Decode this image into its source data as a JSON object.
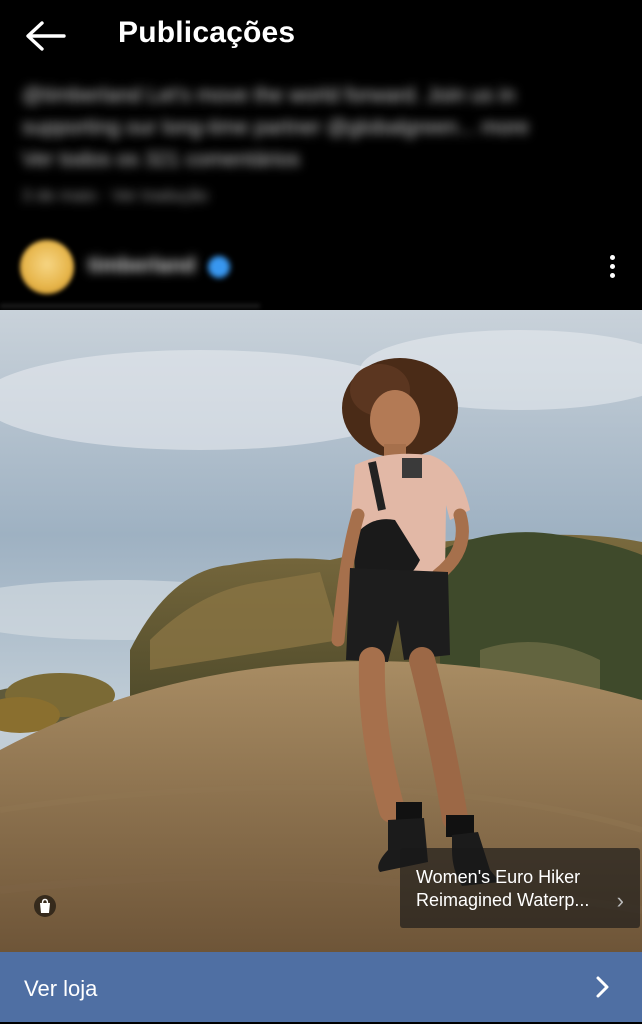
{
  "header": {
    "title": "Publicações",
    "back_icon": "arrow-left-icon"
  },
  "caption": {
    "line1": "@timberland Let's move the world forward. Join us in",
    "line2": "supporting our long-time partner @globalgreen... more",
    "line3": "Ver todos os 321 comentários",
    "line4": "3 de maio · Ver tradução"
  },
  "post": {
    "username": "timberland",
    "more_icon": "more-vertical-icon"
  },
  "product_tag": {
    "name": "Women's Euro Hiker Reimagined Waterp...",
    "chevron": "›"
  },
  "shop_bar": {
    "label": "Ver loja",
    "icon": "chevron-right-icon",
    "color": "#4f6fa3"
  },
  "icons": {
    "shopping_bag": "shopping-bag-icon",
    "verified": "verified-badge-icon"
  }
}
